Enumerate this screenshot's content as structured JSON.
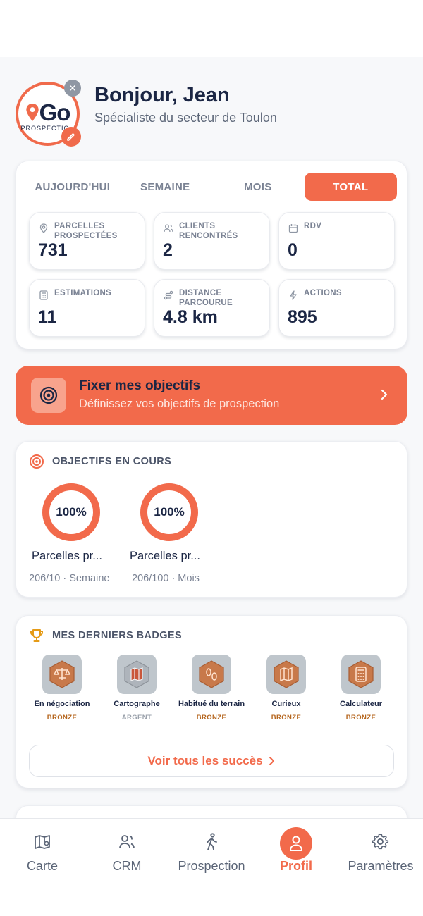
{
  "header": {
    "greeting": "Bonjour, Jean",
    "role": "Spécialiste du secteur de Toulon",
    "logo_text": "Go",
    "logo_sub": "PROSPECTIO"
  },
  "period_tabs": [
    {
      "label": "AUJOURD'HUI",
      "active": false
    },
    {
      "label": "SEMAINE",
      "active": false
    },
    {
      "label": "MOIS",
      "active": false
    },
    {
      "label": "TOTAL",
      "active": true
    }
  ],
  "stats": [
    {
      "label": "PARCELLES PROSPECTÉES",
      "value": "731",
      "icon": "map-pin-icon"
    },
    {
      "label": "CLIENTS RENCONTRÉS",
      "value": "2",
      "icon": "users-icon"
    },
    {
      "label": "RDV",
      "value": "0",
      "icon": "calendar-icon"
    },
    {
      "label": "ESTIMATIONS",
      "value": "11",
      "icon": "calculator-icon"
    },
    {
      "label": "DISTANCE PARCOURUE",
      "value": "4.8 km",
      "icon": "route-icon"
    },
    {
      "label": "ACTIONS",
      "value": "895",
      "icon": "bolt-icon"
    }
  ],
  "goal_banner": {
    "title": "Fixer mes objectifs",
    "subtitle": "Définissez vos objectifs de prospection"
  },
  "objectives": {
    "title": "OBJECTIFS EN COURS",
    "items": [
      {
        "percent_text": "100%",
        "progress": 1.0,
        "name": "Parcelles pr...",
        "meta": "206/10 · Semaine"
      },
      {
        "percent_text": "100%",
        "progress": 1.0,
        "name": "Parcelles pr...",
        "meta": "206/100 · Mois"
      }
    ]
  },
  "badges": {
    "title": "MES DERNIERS BADGES",
    "items": [
      {
        "name": "En négociation",
        "tier": "BRONZE",
        "icon": "scales-icon"
      },
      {
        "name": "Cartographe",
        "tier": "ARGENT",
        "icon": "map-icon"
      },
      {
        "name": "Habitué du terrain",
        "tier": "BRONZE",
        "icon": "footprints-icon"
      },
      {
        "name": "Curieux",
        "tier": "BRONZE",
        "icon": "map-icon"
      },
      {
        "name": "Calculateur",
        "tier": "BRONZE",
        "icon": "calculator-icon"
      }
    ],
    "see_all": "Voir tous les succès"
  },
  "bottom_nav": [
    {
      "label": "Carte",
      "icon": "map-icon",
      "active": false
    },
    {
      "label": "CRM",
      "icon": "users-icon",
      "active": false
    },
    {
      "label": "Prospection",
      "icon": "walking-icon",
      "active": false
    },
    {
      "label": "Profil",
      "icon": "user-icon",
      "active": true
    },
    {
      "label": "Paramètres",
      "icon": "gear-icon",
      "active": false
    }
  ],
  "colors": {
    "accent": "#f26a4b",
    "navy": "#1b2644",
    "bronze": "#b5651d",
    "silver": "#9aa1ab"
  }
}
